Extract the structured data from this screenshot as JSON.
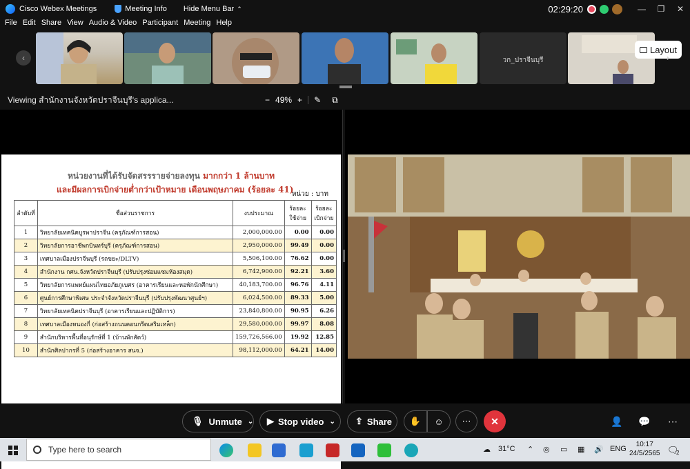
{
  "titlebar": {
    "app_title": "Cisco Webex Meetings",
    "meeting_info": "Meeting Info",
    "hide_menu": "Hide Menu Bar",
    "clock": "02:29:20"
  },
  "menu": [
    "File",
    "Edit",
    "Share",
    "View",
    "Audio & Video",
    "Participant",
    "Meeting",
    "Help"
  ],
  "thumbnails": [
    {
      "name": ""
    },
    {
      "name": ""
    },
    {
      "name": ""
    },
    {
      "name": ""
    },
    {
      "name": ""
    },
    {
      "name": "วก_ปราจีนบุรี"
    },
    {
      "name": ""
    }
  ],
  "layout_label": "Layout",
  "viewing": {
    "text": "Viewing สำนักงานจังหวัดปราจีนบุรี's applica...",
    "zoom_minus": "−",
    "zoom_value": "49%",
    "zoom_plus": "+"
  },
  "document": {
    "title_gray": "หน่วยงานที่ได้รับจัดสรรรายจ่ายลงทุน",
    "title_red": "มากกว่า 1 ล้านบาท",
    "subtitle": "และมีผลการเบิกจ่ายต่ำกว่าเป้าหมาย  เดือนพฤษภาคม (ร้อยละ 41)",
    "unit": "หน่วย : บาท",
    "headers": {
      "no": "ลำดับที่",
      "name": "ชื่อส่วนราชการ",
      "budget": "งบประมาณ",
      "pct_spend": "ร้อยละ ใช้จ่าย",
      "pct_disburse": "ร้อยละ เบิกจ่าย"
    },
    "rows": [
      {
        "no": "1",
        "name": "วิทยาลัยเทคนิคบูรพาปราจีน (ครุภัณฑ์การสอน)",
        "budget": "2,000,000.00",
        "spend": "0.00",
        "disburse": "0.00"
      },
      {
        "no": "2",
        "name": "วิทยาลัยการอาชีพกบินทร์บุรี (ครุภัณฑ์การสอน)",
        "budget": "2,950,000.00",
        "spend": "99.49",
        "disburse": "0.00"
      },
      {
        "no": "3",
        "name": "เทศบาลเมืองปราจีนบุรี (รถขยะ/DLTV)",
        "budget": "5,506,100.00",
        "spend": "76.62",
        "disburse": "0.00"
      },
      {
        "no": "4",
        "name": "สำนักงาน กศน.จังหวัดปราจีนบุรี (ปรับปรุงซ่อมแซมห้องสมุด)",
        "budget": "6,742,900.00",
        "spend": "92.21",
        "disburse": "3.60"
      },
      {
        "no": "5",
        "name": "วิทยาลัยการแพทย์แผนไทยอภัยภูเบศร (อาคารเรียนและหอพักนักศึกษา)",
        "budget": "40,183,700.00",
        "spend": "96.76",
        "disburse": "4.11"
      },
      {
        "no": "6",
        "name": "ศูนย์การศึกษาพิเศษ ประจำจังหวัดปราจีนบุรี (ปรับปรุงพัฒนาศูนย์ฯ)",
        "budget": "6,024,500.00",
        "spend": "89.33",
        "disburse": "5.00"
      },
      {
        "no": "7",
        "name": "วิทยาลัยเทคนิคปราจีนบุรี (อาคารเรียนและปฏิบัติการ)",
        "budget": "23,840,800.00",
        "spend": "90.95",
        "disburse": "6.26"
      },
      {
        "no": "8",
        "name": "เทศบาลเมืองหนองกี่ (ก่อสร้างถนนคอนกรีตเสริมเหล็ก)",
        "budget": "29,580,000.00",
        "spend": "99.97",
        "disburse": "8.08"
      },
      {
        "no": "9",
        "name": "สำนักบริหารพื้นที่อนุรักษ์ที่ 1 (บ้านพักสัตว์)",
        "budget": "159,726,566.00",
        "spend": "19.92",
        "disburse": "12.85"
      },
      {
        "no": "10",
        "name": "สำนักศิลปากรที่ 5 (ก่อสร้างอาคาร สนจ.)",
        "budget": "98,112,000.00",
        "spend": "64.21",
        "disburse": "14.00"
      }
    ]
  },
  "controls": {
    "unmute": "Unmute",
    "stop_video": "Stop video",
    "share": "Share"
  },
  "taskbar": {
    "search_placeholder": "Type here to search",
    "temperature": "31°C",
    "language": "ENG",
    "time": "10:17",
    "date": "24/5/2565",
    "notifications": "2"
  }
}
